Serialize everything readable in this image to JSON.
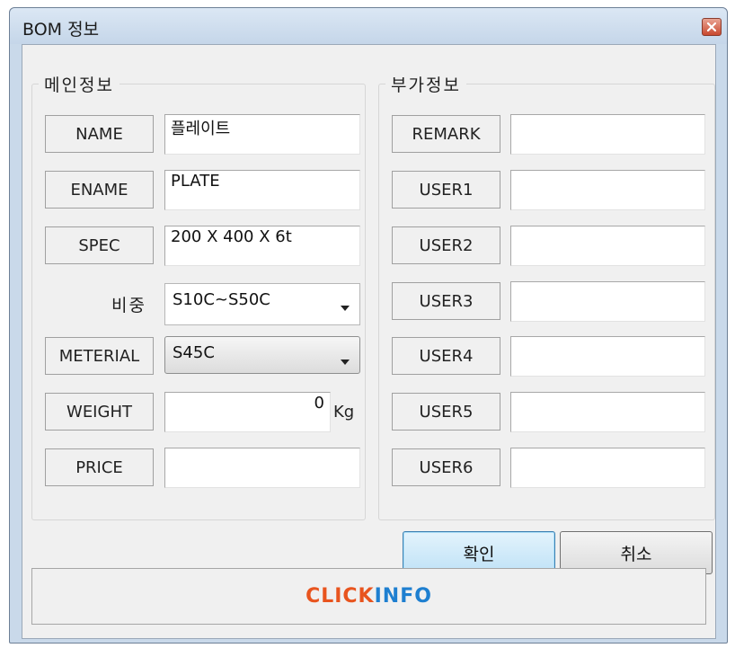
{
  "window": {
    "title": "BOM 정보"
  },
  "main_group": {
    "title": "메인정보",
    "name": {
      "label": "NAME",
      "value": "플레이트"
    },
    "ename": {
      "label": "ENAME",
      "value": "PLATE"
    },
    "spec": {
      "label": "SPEC",
      "value": "200 X 400 X 6t"
    },
    "density": {
      "label": "비중",
      "value": "S10C~S50C"
    },
    "material": {
      "label": "METERIAL",
      "value": "S45C"
    },
    "weight": {
      "label": "WEIGHT",
      "value": "0",
      "unit": "Kg"
    },
    "price": {
      "label": "PRICE",
      "value": ""
    }
  },
  "extra_group": {
    "title": "부가정보",
    "remark": {
      "label": "REMARK",
      "value": ""
    },
    "user1": {
      "label": "USER1",
      "value": ""
    },
    "user2": {
      "label": "USER2",
      "value": ""
    },
    "user3": {
      "label": "USER3",
      "value": ""
    },
    "user4": {
      "label": "USER4",
      "value": ""
    },
    "user5": {
      "label": "USER5",
      "value": ""
    },
    "user6": {
      "label": "USER6",
      "value": ""
    }
  },
  "buttons": {
    "ok": "확인",
    "cancel": "취소"
  },
  "logo": {
    "part1": "CLICK",
    "part2": "INFO",
    "color1": "#e8541e",
    "color2": "#1e7fd0"
  },
  "colors": {
    "titlebar": "#c9d9ea",
    "close": "#c9492f",
    "ok_border": "#3c7fb1"
  }
}
